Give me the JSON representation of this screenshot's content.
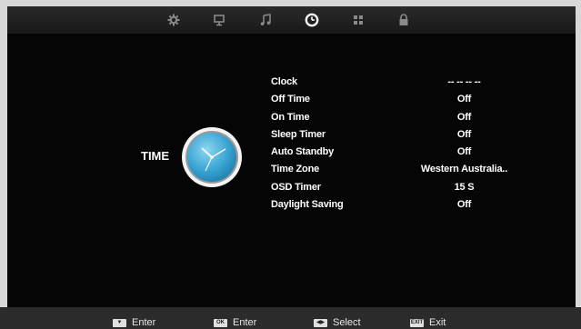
{
  "tabs": [
    {
      "icon": "gear-icon",
      "active": false
    },
    {
      "icon": "monitor-icon",
      "active": false
    },
    {
      "icon": "music-note-icon",
      "active": false
    },
    {
      "icon": "clock-icon",
      "active": true
    },
    {
      "icon": "grid-icon",
      "active": false
    },
    {
      "icon": "lock-icon",
      "active": false
    }
  ],
  "section": {
    "title": "TIME",
    "icon": "clock-icon"
  },
  "menu": [
    {
      "label": "Clock",
      "value": "--  --    --  --"
    },
    {
      "label": "Off Time",
      "value": "Off"
    },
    {
      "label": "On Time",
      "value": "Off"
    },
    {
      "label": "Sleep Timer",
      "value": "Off"
    },
    {
      "label": "Auto Standby",
      "value": "Off"
    },
    {
      "label": "Time Zone",
      "value": "Western Australia.."
    },
    {
      "label": "OSD Timer",
      "value": "15 S"
    },
    {
      "label": "Daylight Saving",
      "value": "Off"
    }
  ],
  "hints": [
    {
      "key": "▼",
      "label": "Enter"
    },
    {
      "key": "OK",
      "label": "Enter"
    },
    {
      "key": "◀▶",
      "label": "Select"
    },
    {
      "key": "EXIT",
      "label": "Exit"
    }
  ],
  "colors": {
    "background": "#050505",
    "text": "#ffffff",
    "clock_face": "#4aaed8",
    "bar": "#2b2b2b"
  }
}
